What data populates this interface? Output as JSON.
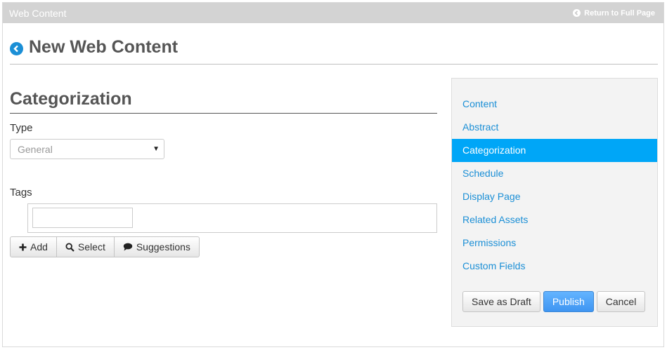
{
  "titlebar": {
    "title": "Web Content",
    "return_label": "Return to Full Page",
    "return_icon": "arrow-left-circle-icon"
  },
  "header": {
    "back_icon": "chevron-left-circle-icon",
    "title": "New Web Content"
  },
  "main": {
    "section_title": "Categorization",
    "type": {
      "label": "Type",
      "selected": "General"
    },
    "tags": {
      "label": "Tags",
      "input_value": "",
      "buttons": {
        "add": "Add",
        "select": "Select",
        "suggestions": "Suggestions"
      }
    }
  },
  "sidebar": {
    "items": [
      {
        "label": "Content"
      },
      {
        "label": "Abstract"
      },
      {
        "label": "Categorization"
      },
      {
        "label": "Schedule"
      },
      {
        "label": "Display Page"
      },
      {
        "label": "Related Assets"
      },
      {
        "label": "Permissions"
      },
      {
        "label": "Custom Fields"
      }
    ],
    "active_index": 2,
    "actions": {
      "save_draft": "Save as Draft",
      "publish": "Publish",
      "cancel": "Cancel"
    }
  },
  "colors": {
    "accent": "#1b8fd6",
    "active_nav": "#00a6f7",
    "titlebar": "#d3d3d3",
    "publish": "#4a9ff5"
  }
}
